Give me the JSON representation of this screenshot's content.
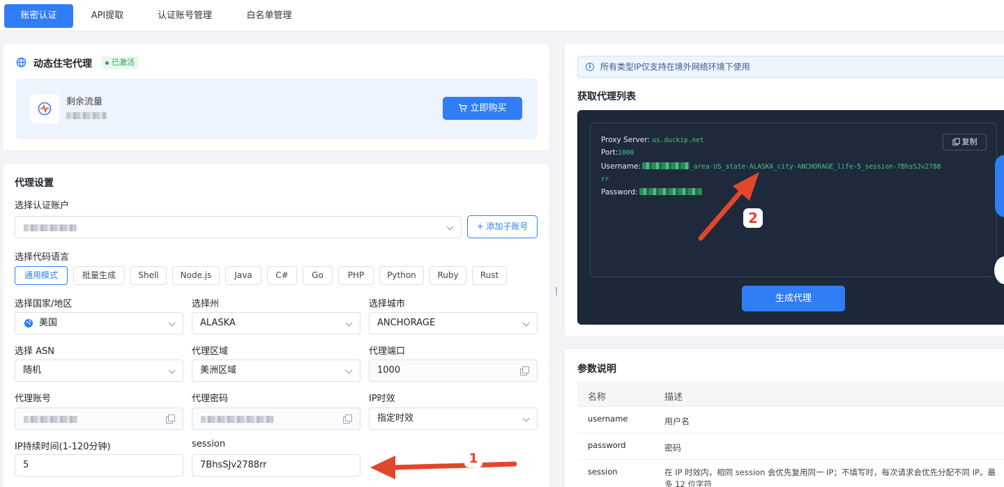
{
  "tabs": [
    {
      "label": "账密认证",
      "active": true
    },
    {
      "label": "API提取",
      "active": false
    },
    {
      "label": "认证账号管理",
      "active": false
    },
    {
      "label": "白名单管理",
      "active": false
    }
  ],
  "product": {
    "title": "动态住宅代理",
    "status": "已激活",
    "remaining_label": "剩余流量",
    "buy_label": "立即购买"
  },
  "settings": {
    "title": "代理设置",
    "account_label": "选择认证账户",
    "add_sub_label": "+ 添加子账号",
    "code_lang_label": "选择代码语言",
    "languages": [
      "通用模式",
      "批量生成",
      "Shell",
      "Node.js",
      "Java",
      "C#",
      "Go",
      "PHP",
      "Python",
      "Ruby",
      "Rust"
    ],
    "country_label": "选择国家/地区",
    "country_value": "美国",
    "state_label": "选择州",
    "state_value": "ALASKA",
    "city_label": "选择城市",
    "city_value": "ANCHORAGE",
    "asn_label": "选择 ASN",
    "asn_value": "随机",
    "region_label": "代理区域",
    "region_value": "美洲区域",
    "port_label": "代理端口",
    "port_value": "1000",
    "account_no_label": "代理账号",
    "password_label": "代理密码",
    "ip_mode_label": "IP时效",
    "ip_mode_value": "指定时效",
    "duration_label": "IP持续时间(1-120分钟)",
    "duration_value": "5",
    "session_label": "session",
    "session_value": "7BhsSJv2788rr"
  },
  "info_notice": "所有类型IP仅支持在境外网络环境下使用",
  "proxy_list": {
    "title": "获取代理列表",
    "copy_label": "复制",
    "server_key": "Proxy Server:",
    "server_value": "us.duckip.net",
    "port_key": "Port:",
    "port_value": "1000",
    "username_key": "Username:",
    "username_value": "_area-US_state-ALASKA_city-ANCHORAGE_life-5_session-7BhsSJv2788",
    "username_wrap": "rr",
    "password_key": "Password:",
    "generate_label": "生成代理"
  },
  "params": {
    "title": "参数说明",
    "headers": [
      "名称",
      "描述"
    ],
    "rows": [
      {
        "name": "username",
        "desc": "用户名"
      },
      {
        "name": "password",
        "desc": "密码"
      },
      {
        "name": "session",
        "desc": "在 IP 时效内，相同 session 会优先复用同一 IP；不填写时，每次请求会优先分配不同 IP。最",
        "desc2": "多 12 位字符"
      }
    ]
  },
  "annotations": {
    "arrow1": "1",
    "arrow2": "2"
  },
  "colors": {
    "accent": "#2f7ef5",
    "success": "#2fa35a",
    "dark_panel": "#1d2838",
    "arrow": "#e2462b"
  }
}
